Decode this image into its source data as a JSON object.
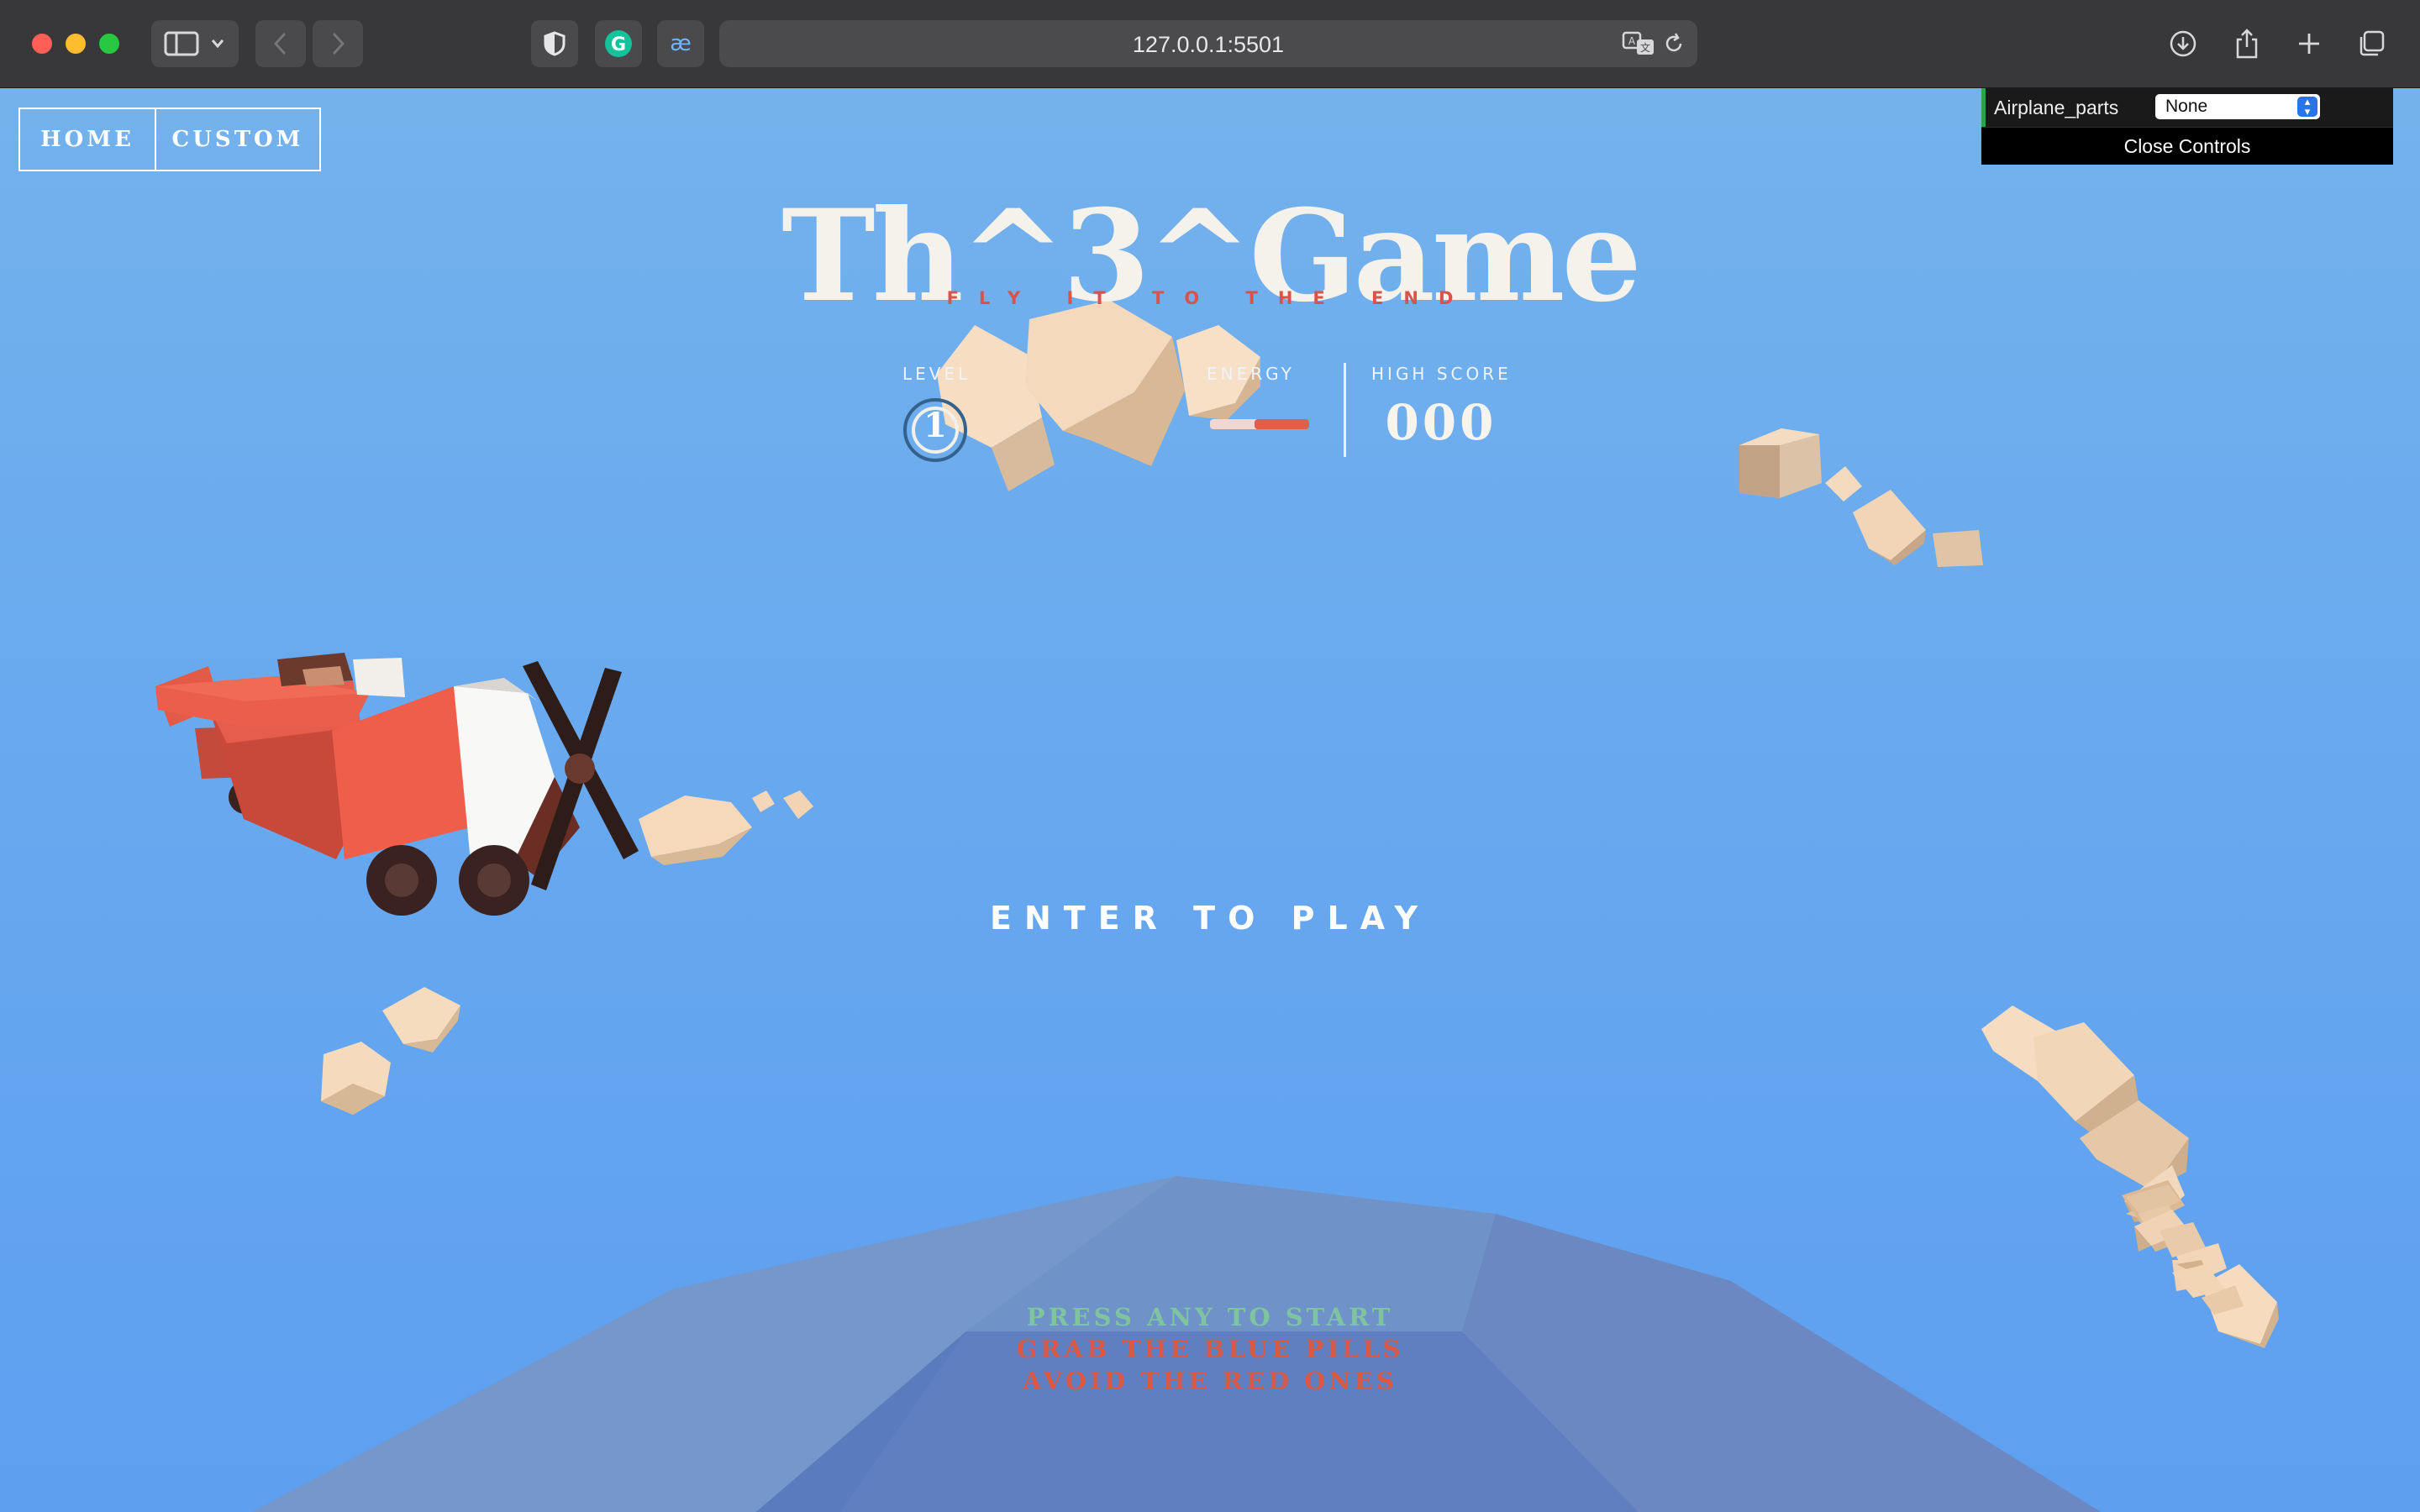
{
  "browser": {
    "url": "127.0.0.1:5501",
    "colors": {
      "close": "#ff5f57",
      "minimize": "#febc2e",
      "maximize": "#28c840"
    }
  },
  "nav": {
    "home_label": "HOME",
    "custom_label": "CUSTOM"
  },
  "controls": {
    "parameter_label": "Airplane_parts",
    "selected_value": "None",
    "close_label": "Close Controls"
  },
  "game": {
    "title": "Th^3^Game",
    "subtitle": "FLY IT TO THE END",
    "level_label": "LEVEL",
    "level_value": "1",
    "energy_label": "ENERGY",
    "energy_level": 0.55,
    "high_score_label": "HIGH SCORE",
    "high_score_value": "000",
    "enter_prompt": "ENTER TO PLAY",
    "instructions": [
      {
        "text": "PRESS ANY TO START",
        "color": "#7ec4a0"
      },
      {
        "text": "GRAB THE BLUE PILLS",
        "color": "#d85a46"
      },
      {
        "text": "AVOID THE RED ONES",
        "color": "#d85a46"
      }
    ]
  },
  "colors": {
    "sky_top": "#74b2ec",
    "sky_bottom": "#5e9ff0",
    "plane_red": "#e8574a",
    "cloud": "#f5dcc0"
  }
}
